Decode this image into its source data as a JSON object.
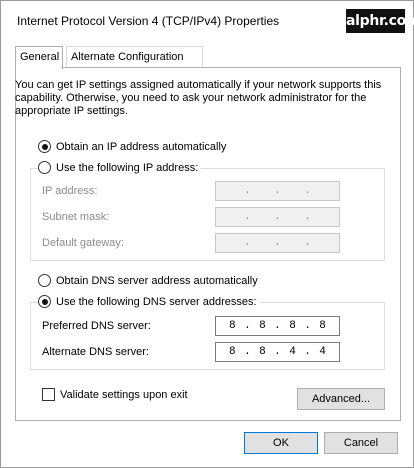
{
  "window": {
    "title": "Internet Protocol Version 4 (TCP/IPv4) Properties",
    "logo_text": "alphr.com"
  },
  "tabs": [
    {
      "label": "General",
      "active": true
    },
    {
      "label": "Alternate Configuration",
      "active": false
    }
  ],
  "description": "You can get IP settings assigned automatically if your network supports this capability. Otherwise, you need to ask your network administrator for the appropriate IP settings.",
  "ip_section": {
    "auto_label": "Obtain an IP address automatically",
    "auto_selected": true,
    "manual_label": "Use the following IP address:",
    "manual_selected": false,
    "fields": [
      {
        "label": "IP address:",
        "value": [
          "",
          "",
          "",
          ""
        ],
        "enabled": false
      },
      {
        "label": "Subnet mask:",
        "value": [
          "",
          "",
          "",
          ""
        ],
        "enabled": false
      },
      {
        "label": "Default gateway:",
        "value": [
          "",
          "",
          "",
          ""
        ],
        "enabled": false
      }
    ]
  },
  "dns_section": {
    "auto_label": "Obtain DNS server address automatically",
    "auto_selected": false,
    "manual_label": "Use the following DNS server addresses:",
    "manual_selected": true,
    "fields": [
      {
        "label": "Preferred DNS server:",
        "value": [
          "8",
          "8",
          "8",
          "8"
        ],
        "enabled": true
      },
      {
        "label": "Alternate DNS server:",
        "value": [
          "8",
          "8",
          "4",
          "4"
        ],
        "enabled": true
      }
    ]
  },
  "validate": {
    "label": "Validate settings upon exit",
    "checked": false
  },
  "buttons": {
    "advanced": "Advanced...",
    "ok": "OK",
    "cancel": "Cancel"
  },
  "dot": "."
}
